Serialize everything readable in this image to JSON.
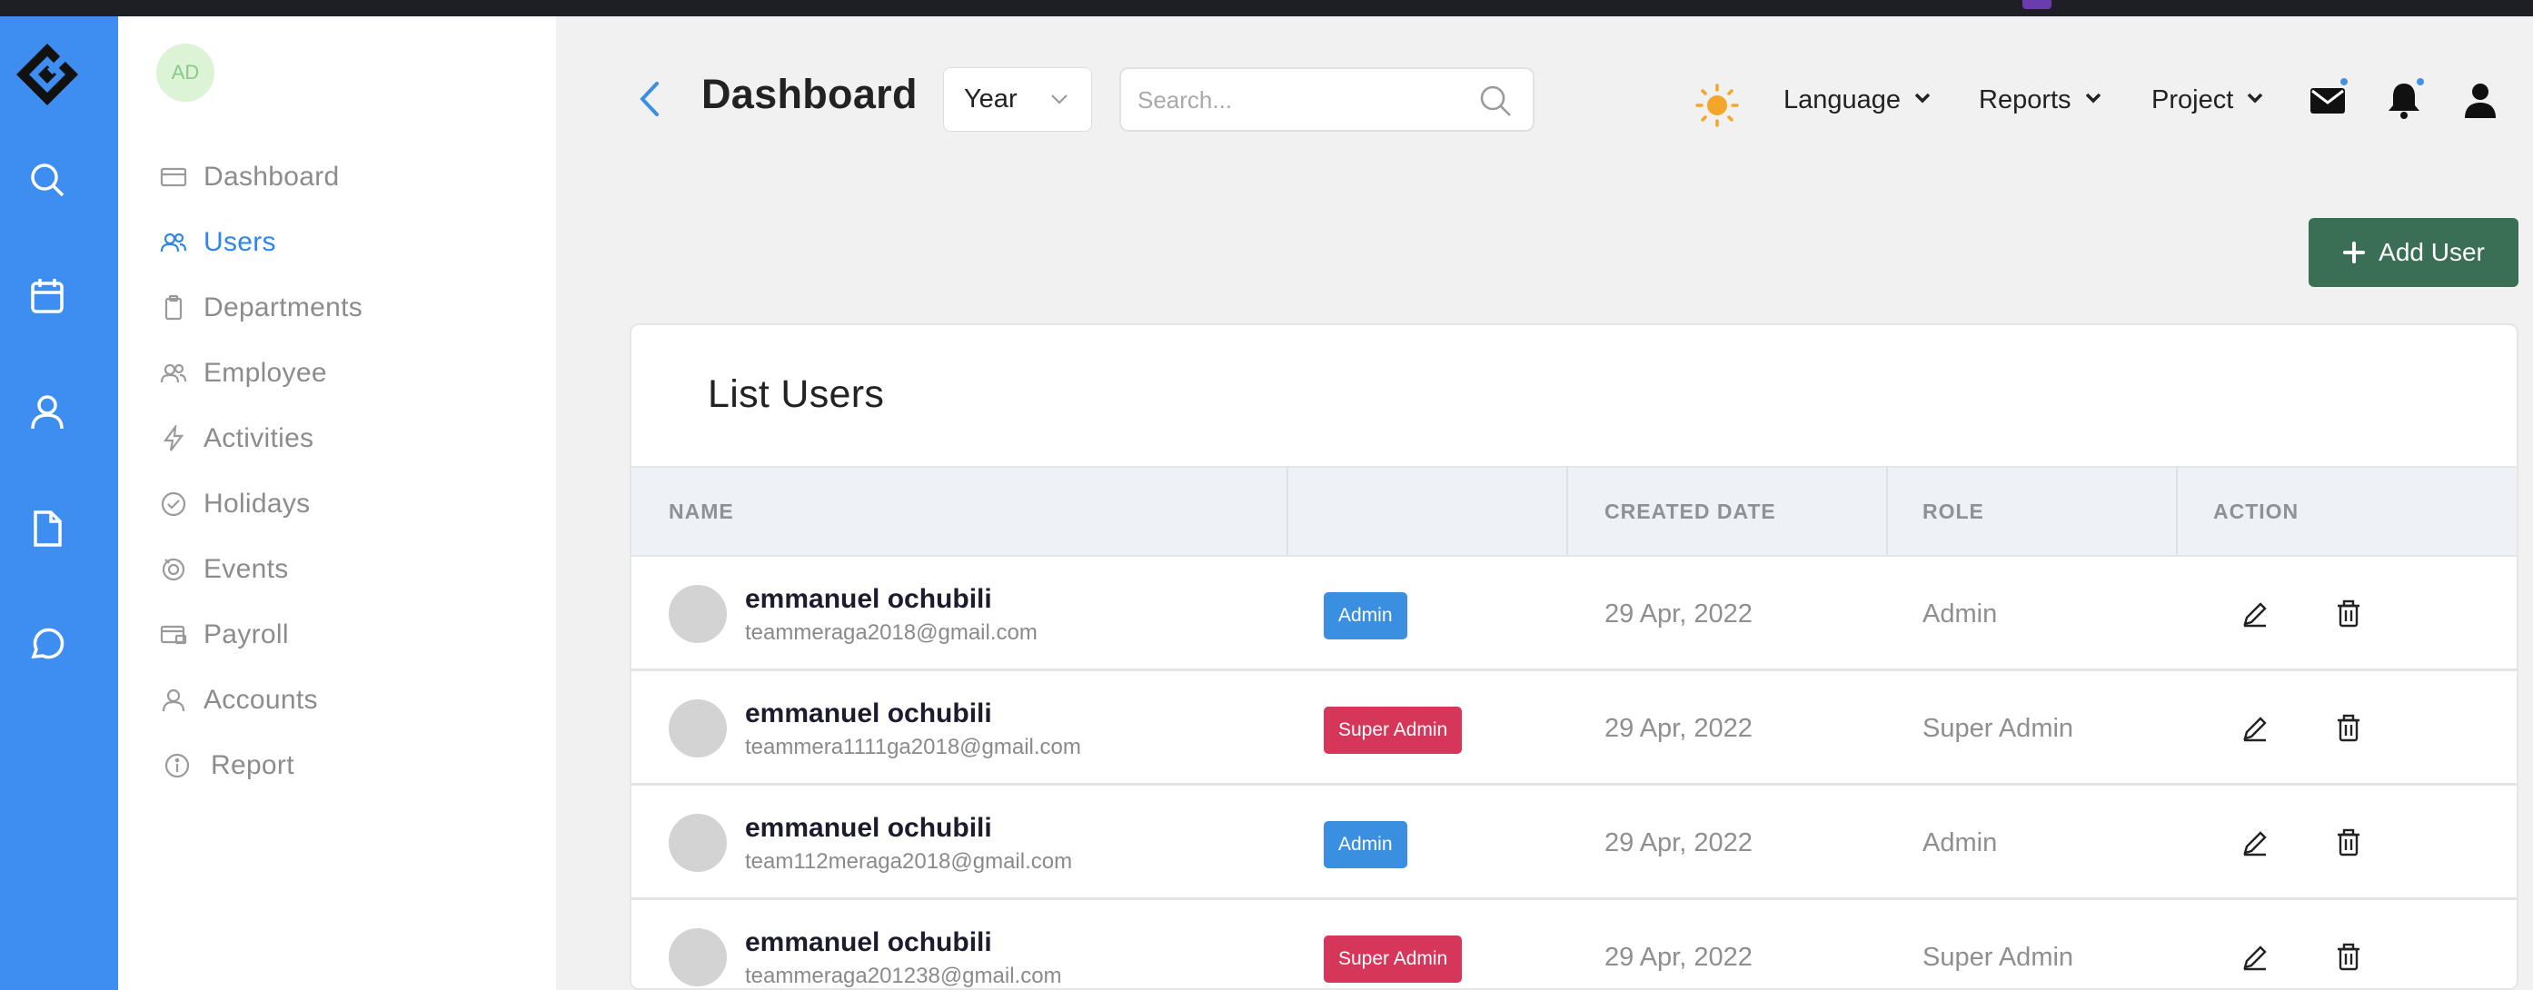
{
  "sidebar": {
    "avatar_initials": "AD",
    "items": [
      {
        "label": "Dashboard",
        "icon": "card-icon"
      },
      {
        "label": "Users",
        "icon": "users-icon",
        "active": true
      },
      {
        "label": "Departments",
        "icon": "clipboard-icon"
      },
      {
        "label": "Employee",
        "icon": "users-icon"
      },
      {
        "label": "Activities",
        "icon": "zap-icon"
      },
      {
        "label": "Holidays",
        "icon": "check-circle-icon"
      },
      {
        "label": "Events",
        "icon": "award-icon"
      },
      {
        "label": "Payroll",
        "icon": "credit-card-icon"
      },
      {
        "label": "Accounts",
        "icon": "user-icon"
      },
      {
        "label": "Report",
        "icon": "info-icon"
      }
    ]
  },
  "rail": {
    "icons": [
      "logo-icon",
      "search-icon",
      "calendar-icon",
      "user-icon",
      "file-icon",
      "chat-icon"
    ],
    "color": "#3d8ef0"
  },
  "header": {
    "title": "Dashboard",
    "period_select": "Year",
    "search_placeholder": "Search...",
    "menus": [
      "Language",
      "Reports",
      "Project"
    ],
    "icons": [
      "sun-icon",
      "mail-icon",
      "bell-icon",
      "profile-icon"
    ]
  },
  "actions": {
    "add_user": "Add User",
    "add_user_color": "#3a6f55"
  },
  "table": {
    "title": "List Users",
    "columns": [
      "NAME",
      "",
      "CREATED DATE",
      "ROLE",
      "ACTION"
    ],
    "rows": [
      {
        "name": "emmanuel ochubili",
        "email": "teammeraga2018@gmail.com",
        "badge": "Admin",
        "badge_color": "#3b8fe0",
        "created": "29 Apr, 2022",
        "role": "Admin"
      },
      {
        "name": "emmanuel ochubili",
        "email": "teammera1111ga2018@gmail.com",
        "badge": "Super Admin",
        "badge_color": "#d6365a",
        "created": "29 Apr, 2022",
        "role": "Super Admin"
      },
      {
        "name": "emmanuel ochubili",
        "email": "team112meraga2018@gmail.com",
        "badge": "Admin",
        "badge_color": "#3b8fe0",
        "created": "29 Apr, 2022",
        "role": "Admin"
      },
      {
        "name": "emmanuel ochubili",
        "email": "teammeraga201238@gmail.com",
        "badge": "Super Admin",
        "badge_color": "#d6365a",
        "created": "29 Apr, 2022",
        "role": "Super Admin"
      }
    ]
  }
}
